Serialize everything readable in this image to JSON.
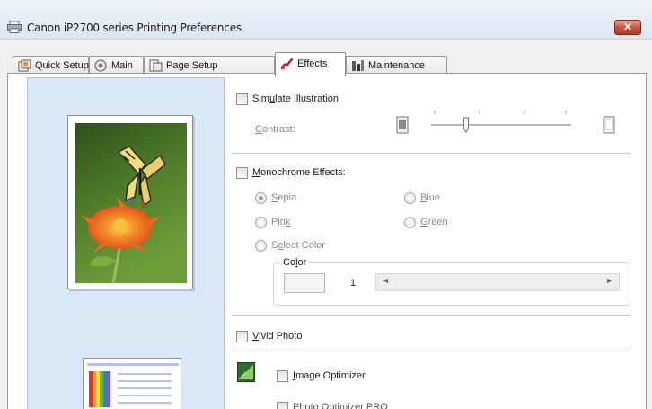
{
  "window": {
    "title": "Canon iP2700 series Printing Preferences",
    "close_label": "✕"
  },
  "tabs": [
    {
      "label": "Quick Setup",
      "icon": "quick-setup-icon"
    },
    {
      "label": "Main",
      "icon": "main-icon"
    },
    {
      "label": "Page Setup",
      "icon": "page-setup-icon"
    },
    {
      "label": "Effects",
      "icon": "effects-icon",
      "active": true
    },
    {
      "label": "Maintenance",
      "icon": "maintenance-icon"
    }
  ],
  "effects": {
    "simulate_illustration": {
      "label_pre": "Sim",
      "label_u": "u",
      "label_post": "late Illustration",
      "checked": false
    },
    "contrast": {
      "label_u": "C",
      "label_post": "ontrast:",
      "level": 0.25
    },
    "monochrome": {
      "label_u": "M",
      "label_post": "onochrome Effects:",
      "checked": false,
      "options": [
        {
          "u": "S",
          "post": "epia",
          "selected": true
        },
        {
          "u": "B",
          "post": "lue",
          "selected": false
        },
        {
          "pre": "Pin",
          "u": "k",
          "post": "",
          "selected": false
        },
        {
          "u": "G",
          "post": "reen",
          "selected": false
        },
        {
          "pre": "S",
          "u": "e",
          "post": "lect Color",
          "selected": false
        }
      ]
    },
    "color_group": {
      "legend_pre": "Co",
      "legend_u": "l",
      "legend_post": "or",
      "value": "1",
      "scroll_left": "◄",
      "scroll_right": "►"
    },
    "vivid_photo": {
      "label_u": "V",
      "label_post": "ivid Photo",
      "checked": false
    },
    "image_optimizer": {
      "label_u": "I",
      "label_post": "mage Optimizer",
      "checked": false
    },
    "photo_optimizer_partial": "Photo Optimizer PRO"
  },
  "colors": {
    "accent": "#3c7bd9",
    "preview_bg": "#dbe8f7",
    "close_red": "#c4523a"
  }
}
